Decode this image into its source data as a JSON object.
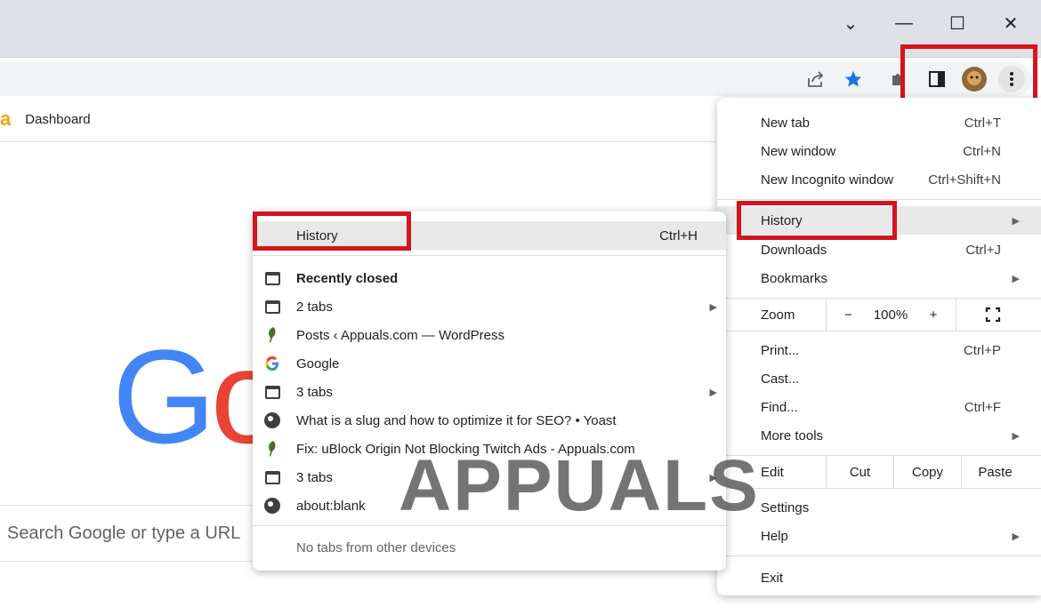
{
  "window_controls": {
    "dropdown": "⌄",
    "minimize": "—",
    "maximize": "☐",
    "close": "✕"
  },
  "bookmarks_bar": {
    "favicon_letter": "a",
    "dashboard_label": "Dashboard"
  },
  "google": {
    "logo_G": "G",
    "logo_o": "o",
    "search_placeholder": "Search Google or type a URL"
  },
  "colors": {
    "highlight_red": "#d4141e",
    "google_blue": "#4285f4",
    "google_red": "#ea4335",
    "star_blue": "#1a73e8"
  },
  "chrome_menu": {
    "new_tab": {
      "label": "New tab",
      "shortcut": "Ctrl+T"
    },
    "new_window": {
      "label": "New window",
      "shortcut": "Ctrl+N"
    },
    "new_incognito": {
      "label": "New Incognito window",
      "shortcut": "Ctrl+Shift+N"
    },
    "history": {
      "label": "History"
    },
    "downloads": {
      "label": "Downloads",
      "shortcut": "Ctrl+J"
    },
    "bookmarks": {
      "label": "Bookmarks"
    },
    "zoom": {
      "label": "Zoom",
      "minus": "−",
      "level": "100%",
      "plus": "+"
    },
    "print": {
      "label": "Print...",
      "shortcut": "Ctrl+P"
    },
    "cast": {
      "label": "Cast..."
    },
    "find": {
      "label": "Find...",
      "shortcut": "Ctrl+F"
    },
    "more_tools": {
      "label": "More tools"
    },
    "edit": {
      "label": "Edit",
      "cut": "Cut",
      "copy": "Copy",
      "paste": "Paste"
    },
    "settings": {
      "label": "Settings"
    },
    "help": {
      "label": "Help"
    },
    "exit": {
      "label": "Exit"
    }
  },
  "history_menu": {
    "history": {
      "label": "History",
      "shortcut": "Ctrl+H"
    },
    "recently_closed": "Recently closed",
    "items": [
      {
        "label": "2 tabs",
        "icon": "tab-icon"
      },
      {
        "label": "Posts ‹ Appuals.com — WordPress",
        "icon": "appuals-favicon-icon"
      },
      {
        "label": "Google",
        "icon": "google-g-icon"
      },
      {
        "label": "3 tabs",
        "icon": "tab-icon"
      },
      {
        "label": "What is a slug and how to optimize it for SEO? • Yoast",
        "icon": "globe-icon"
      },
      {
        "label": "Fix: uBlock Origin Not Blocking Twitch Ads - Appuals.com",
        "icon": "appuals-favicon-icon"
      },
      {
        "label": "3 tabs",
        "icon": "tab-icon"
      },
      {
        "label": "about:blank",
        "icon": "globe-icon"
      }
    ],
    "no_tabs": "No tabs from other devices"
  },
  "watermark": "APPUALS"
}
